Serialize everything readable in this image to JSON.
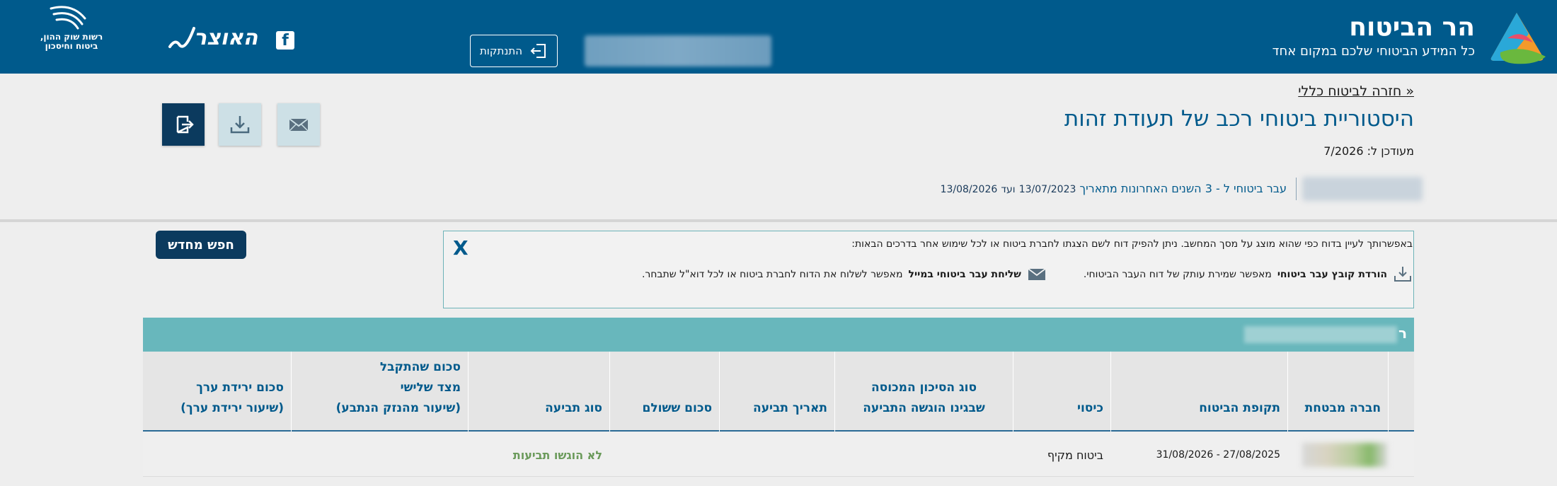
{
  "header": {
    "brand_title": "הר הביטוח",
    "brand_subtitle": "כל המידע הביטוחי שלכם במקום אחד",
    "logout_label": "התנתקות",
    "otsar_logo_text": "האוצר",
    "regulator_text": "רשות שוק ההון, ביטוח וחיסכון",
    "colors": {
      "header_bg": "#005a8c"
    }
  },
  "page": {
    "back_link": "« חזרה לביטוח כללי",
    "title": "היסטוריית ביטוחי רכב של תעודת זהות",
    "updated": "מעודכן ל: 7/2026",
    "period_label": "עבר ביטוחי ל - 3 השנים האחרונות מתאריך",
    "period_from": "13/07/2023",
    "period_mid": "ועד",
    "period_to": "13/08/2026"
  },
  "actions": {
    "mail_icon": "mail-icon",
    "download_icon": "download-icon",
    "exit_icon": "exit-icon"
  },
  "info": {
    "close": "X",
    "line1": "באפשרותך לעיין בדוח כפי שהוא מוצג על מסך המחשב. ניתן להפיק דוח לשם הצגתו לחברת ביטוח או לכל שימוש אחר בדרכים הבאות:",
    "download_bold": "הורדת קובץ עבר ביטוחי",
    "download_text": "מאפשר שמירת עותק של דוח העבר הביטוחי.",
    "mail_bold": "שליחת עבר ביטוחי במייל",
    "mail_text": "מאפשר לשלוח את הדוח לחברת ביטוח או לכל דוא\"ל שתבחר."
  },
  "search_again": "חפש מחדש",
  "table": {
    "header_letter": "ר",
    "columns": [
      {
        "l1": "",
        "l2": "",
        "l3": "חברה מבטחת"
      },
      {
        "l1": "",
        "l2": "",
        "l3": "תקופת הביטוח"
      },
      {
        "l1": "",
        "l2": "",
        "l3": "כיסוי"
      },
      {
        "l1": "",
        "l2": "סוג הסיכון המכוסה",
        "l3": "שבגינו הוגשה התביעה"
      },
      {
        "l1": "",
        "l2": "",
        "l3": "תאריך תביעה"
      },
      {
        "l1": "",
        "l2": "",
        "l3": "סכום ששולם"
      },
      {
        "l1": "",
        "l2": "",
        "l3": "סוג תביעה"
      },
      {
        "l1": "סכום שהתקבל",
        "l2": "מצד שלישי",
        "l3": "(שיעור מהנזק הנתבע)"
      },
      {
        "l1": "",
        "l2": "סכום ירידת ערך",
        "l3": "(שיעור ירידת ערך)"
      }
    ],
    "rows": [
      {
        "period": "27/08/2025 - 31/08/2026",
        "coverage": "ביטוח מקיף",
        "claim_type": "לא הוגשו תביעות"
      }
    ]
  }
}
